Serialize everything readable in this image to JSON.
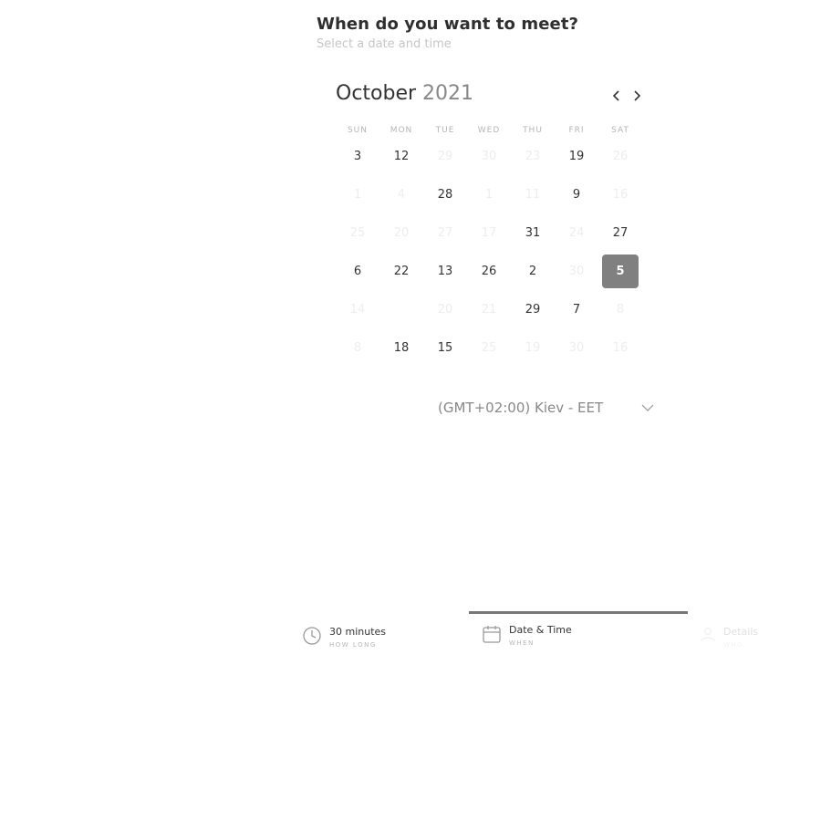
{
  "header": {
    "title": "When do you want to meet?",
    "subtitle": "Select a date and time"
  },
  "calendar": {
    "month": "October",
    "year": "2021",
    "weekdays": [
      "SUN",
      "MON",
      "TUE",
      "WED",
      "THU",
      "FRI",
      "SAT"
    ],
    "weeks": [
      [
        {
          "label": "3",
          "state": "available"
        },
        {
          "label": "12",
          "state": "available"
        },
        {
          "label": "29",
          "state": "disabled"
        },
        {
          "label": "30",
          "state": "disabled"
        },
        {
          "label": "23",
          "state": "disabled"
        },
        {
          "label": "19",
          "state": "available"
        },
        {
          "label": "26",
          "state": "disabled"
        }
      ],
      [
        {
          "label": "1",
          "state": "disabled"
        },
        {
          "label": "4",
          "state": "disabled"
        },
        {
          "label": "28",
          "state": "available"
        },
        {
          "label": "1",
          "state": "disabled"
        },
        {
          "label": "11",
          "state": "disabled"
        },
        {
          "label": "9",
          "state": "available"
        },
        {
          "label": "16",
          "state": "disabled"
        }
      ],
      [
        {
          "label": "25",
          "state": "disabled"
        },
        {
          "label": "20",
          "state": "disabled"
        },
        {
          "label": "27",
          "state": "disabled"
        },
        {
          "label": "17",
          "state": "disabled"
        },
        {
          "label": "31",
          "state": "available"
        },
        {
          "label": "24",
          "state": "disabled"
        },
        {
          "label": "27",
          "state": "available"
        }
      ],
      [
        {
          "label": "6",
          "state": "available"
        },
        {
          "label": "22",
          "state": "available"
        },
        {
          "label": "13",
          "state": "available"
        },
        {
          "label": "26",
          "state": "available"
        },
        {
          "label": "2",
          "state": "available"
        },
        {
          "label": "30",
          "state": "disabled"
        },
        {
          "label": "5",
          "state": "selected"
        }
      ],
      [
        {
          "label": "14",
          "state": "disabled"
        },
        {
          "label": "",
          "state": "disabled"
        },
        {
          "label": "20",
          "state": "disabled"
        },
        {
          "label": "21",
          "state": "disabled"
        },
        {
          "label": "29",
          "state": "available"
        },
        {
          "label": "7",
          "state": "available"
        },
        {
          "label": "8",
          "state": "disabled"
        }
      ],
      [
        {
          "label": "8",
          "state": "disabled"
        },
        {
          "label": "18",
          "state": "available"
        },
        {
          "label": "15",
          "state": "available"
        },
        {
          "label": "25",
          "state": "disabled"
        },
        {
          "label": "19",
          "state": "disabled"
        },
        {
          "label": "30",
          "state": "disabled"
        },
        {
          "label": "16",
          "state": "disabled"
        }
      ]
    ]
  },
  "timezone": {
    "label": "(GMT+02:00) Kiev - EET",
    "icon": "chevron-down-icon"
  },
  "steps": [
    {
      "title": "30 minutes",
      "caption": "HOW LONG",
      "icon": "clock-icon"
    },
    {
      "title": "Date & Time",
      "caption": "WHEN",
      "icon": "calendar-icon"
    },
    {
      "title": "Details",
      "caption": "WHO",
      "icon": "person-icon"
    }
  ],
  "colors": {
    "selected_bg": "#808080",
    "available_text": "#333333",
    "disabled_text": "#eeeeee",
    "active_bar": "#777777"
  }
}
